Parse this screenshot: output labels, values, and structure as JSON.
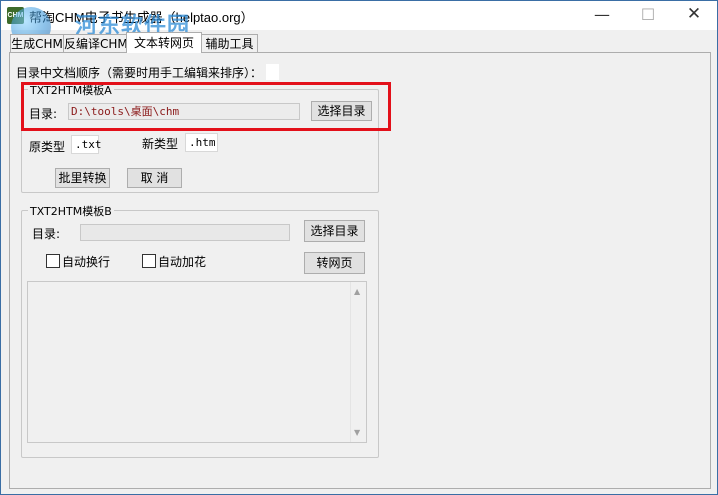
{
  "window": {
    "title": "帮淘CHM电子书生成器（helptao.org）",
    "app_icon_label": "CHM",
    "controls": {
      "minimize": "—",
      "maximize": "☐",
      "close": "✕"
    }
  },
  "watermark": {
    "text": "河东软件园",
    "url": "www.pc0359.cn"
  },
  "tabs": [
    {
      "label": "生成CHM"
    },
    {
      "label": "反编译CHM"
    },
    {
      "label": "文本转网页",
      "active": true
    },
    {
      "label": "辅助工具"
    }
  ],
  "panel": {
    "order_label": "目录中文档顺序（需要时用手工编辑来排序）：",
    "groupA": {
      "title": "TXT2HTM模板A",
      "dir_label": "目录:",
      "dir_value": "D:\\tools\\桌面\\chm",
      "select_dir_button": "选择目录",
      "orig_type_label": "原类型",
      "orig_type_value": ".txt",
      "new_type_label": "新类型",
      "new_type_value": ".htm",
      "batch_convert_button": "批里转换",
      "cancel_button": "取 消"
    },
    "groupB": {
      "title": "TXT2HTM模板B",
      "dir_label": "目录:",
      "dir_value": "",
      "select_dir_button": "选择目录",
      "auto_wrap_label": "自动换行",
      "auto_decor_label": "自动加花",
      "to_web_button": "转网页"
    }
  },
  "highlight_color": "#e3101a"
}
